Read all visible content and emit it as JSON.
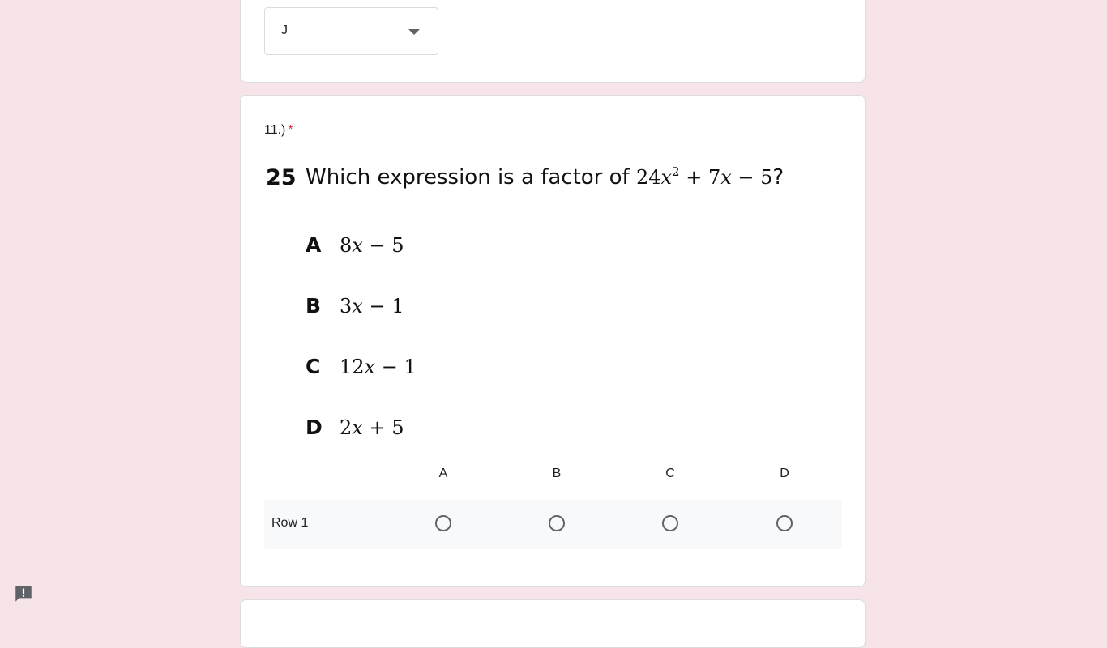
{
  "previous_question": {
    "dropdown_value": "J"
  },
  "question": {
    "title": "11.)",
    "required_marker": "*",
    "problem_number": "25",
    "problem_text_prefix": "Which expression is a factor of ",
    "problem_expression": {
      "coef": "24",
      "var": "x",
      "exp": "2",
      "rest_plus": " + 7",
      "rest_var": "x",
      "rest_tail": " − 5"
    },
    "problem_text_suffix": "?",
    "choices": [
      {
        "letter": "A",
        "coef": "8",
        "var": "x",
        "tail": " − 5"
      },
      {
        "letter": "B",
        "coef": "3",
        "var": "x",
        "tail": " − 1"
      },
      {
        "letter": "C",
        "coef": "12",
        "var": "x",
        "tail": " − 1"
      },
      {
        "letter": "D",
        "coef": "2",
        "var": "x",
        "tail": " + 5"
      }
    ],
    "grid": {
      "columns": [
        "A",
        "B",
        "C",
        "D"
      ],
      "rows": [
        {
          "label": "Row 1",
          "selected": null
        }
      ]
    }
  },
  "colors": {
    "page_background": "#f6e4e8",
    "required": "#d93025",
    "radio_border": "#5f6368"
  },
  "icons": {
    "feedback": "feedback-icon",
    "dropdown": "dropdown-arrow-icon"
  }
}
